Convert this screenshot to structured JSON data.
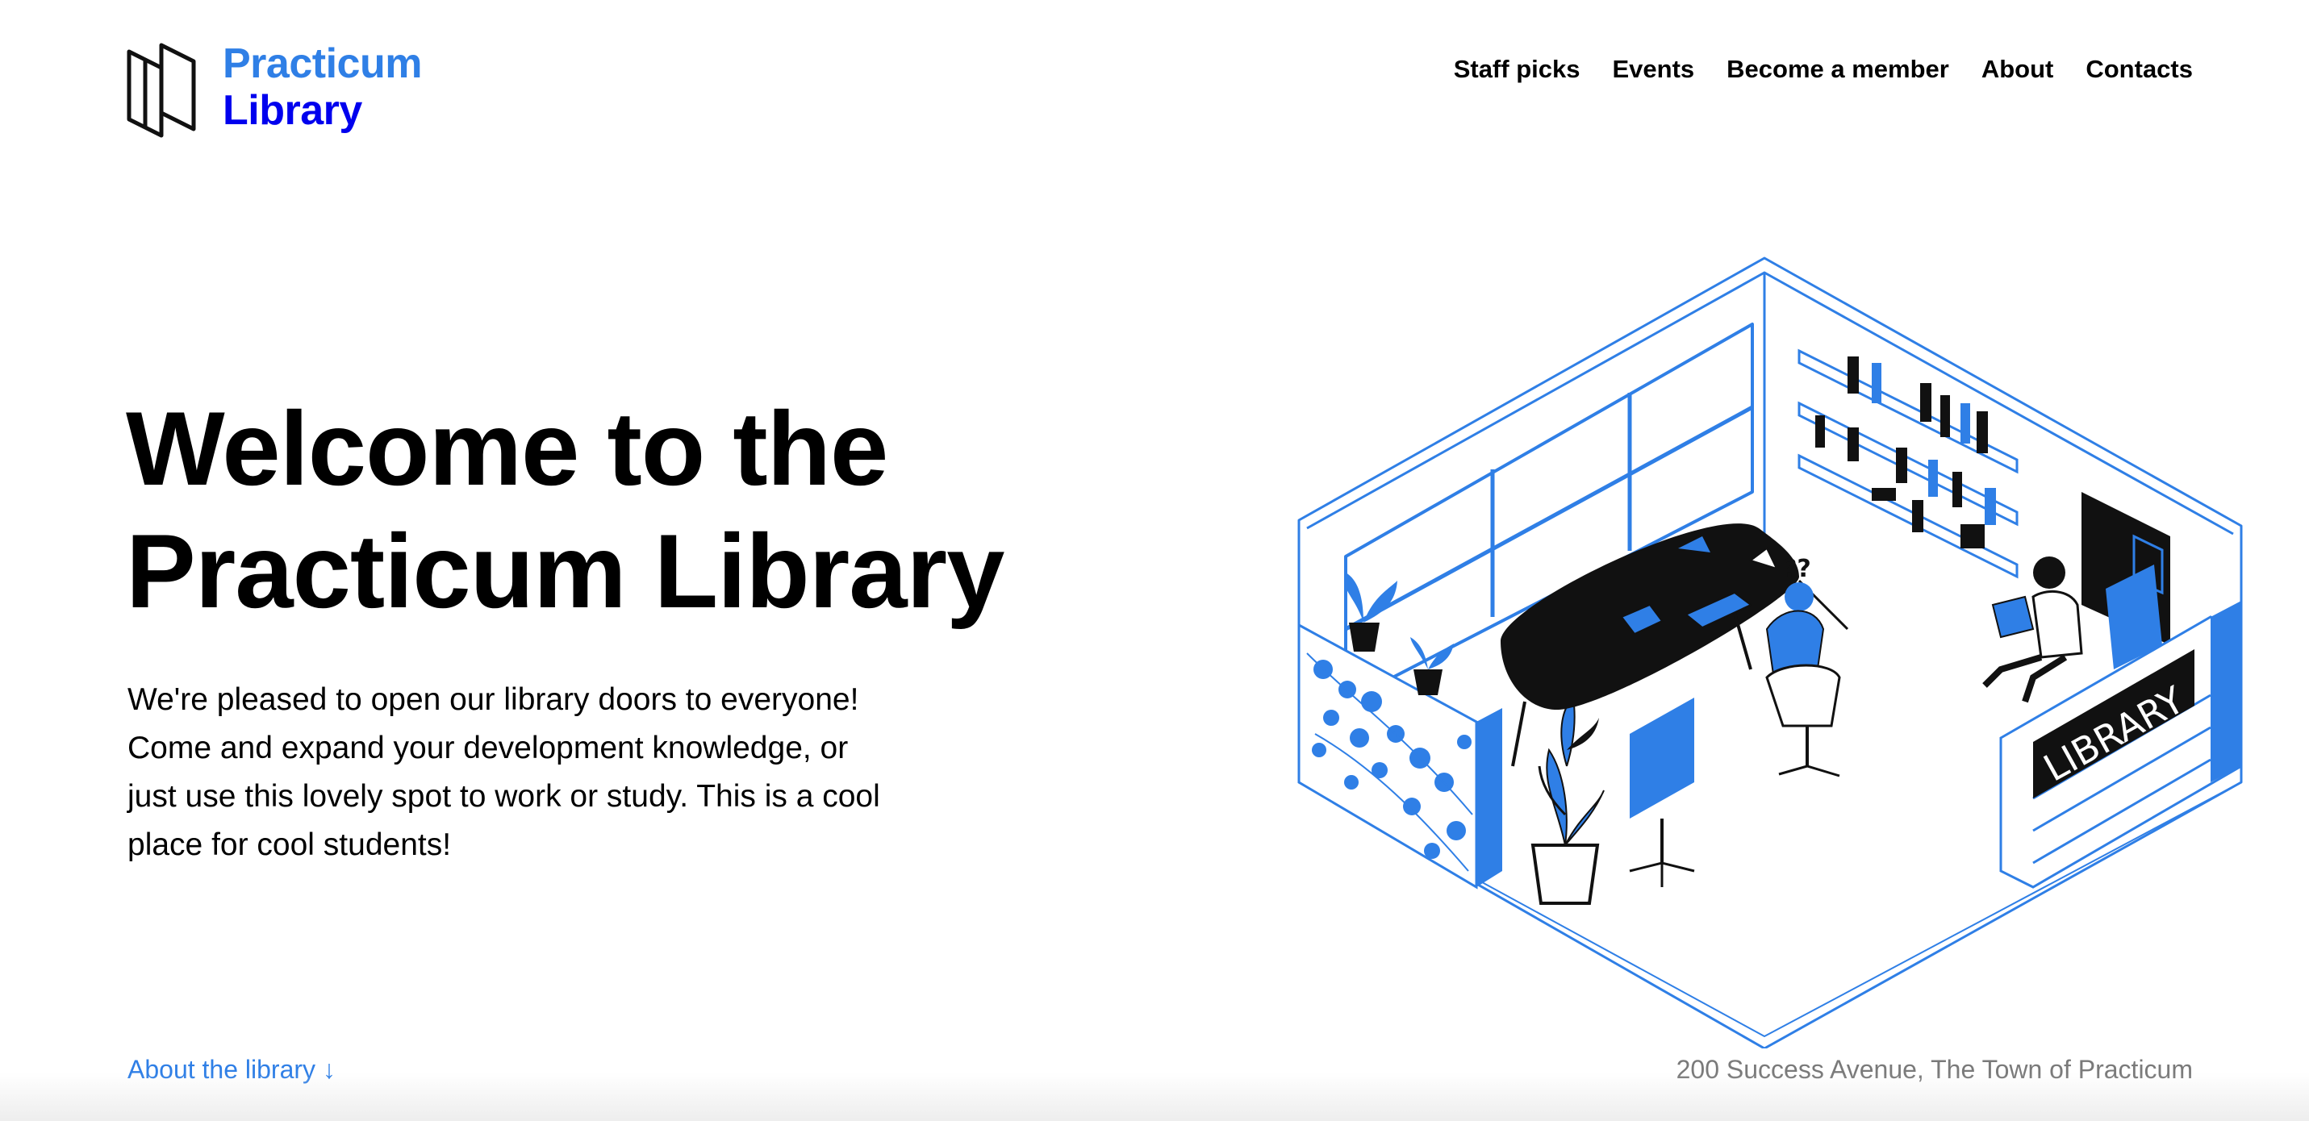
{
  "colors": {
    "accent": "#2f7fe6",
    "text": "#000000",
    "muted": "#7a7a7a",
    "background": "#ffffff"
  },
  "logo": {
    "line1": "Practicum",
    "line2": "Library",
    "icon": "books-logo-icon"
  },
  "nav": {
    "items": [
      {
        "label": "Staff picks"
      },
      {
        "label": "Events"
      },
      {
        "label": "Become a member"
      },
      {
        "label": "About"
      },
      {
        "label": "Contacts"
      }
    ]
  },
  "hero": {
    "title_line1": "Welcome to the",
    "title_line2": "Practicum Library",
    "description": "We're pleased to open our library doors to everyone! Come and expand your development knowledge, or just use this lovely spot to work or study. This is a cool place for cool students!"
  },
  "illustration": {
    "sign_text": "LIBRARY",
    "question_marks": "??"
  },
  "footer": {
    "about_link": "About the library ↓",
    "address": "200 Success Avenue, The Town of Practicum"
  }
}
